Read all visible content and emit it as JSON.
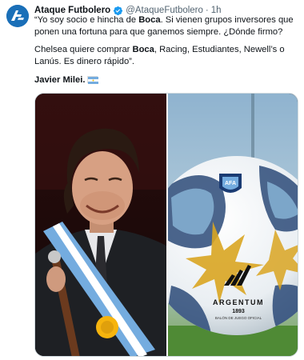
{
  "tweet": {
    "author_name": "Ataque Futbolero",
    "handle": "@AtaqueFutbolero",
    "separator": "·",
    "time": "1h",
    "paragraph1": {
      "pre": "“Yo soy socio e hincha de ",
      "bold": "Boca",
      "post": ". Si vienen grupos inversores que ponen una fortuna para que ganemos siempre. ¿Dónde firmo?"
    },
    "paragraph2": {
      "pre": "Chelsea quiere comprar ",
      "bold": "Boca",
      "post": ", Racing, Estudiantes, Newell’s o Lanús. Es dinero rápido”."
    },
    "signature": "Javier Milei.",
    "ball_text_main": "ARGENTUM",
    "ball_text_year": "1893",
    "ball_text_sub": "BALÓN DE JUEGO OFICIAL",
    "badge_text": "AFA"
  },
  "colors": {
    "verified": "#1d9bf0",
    "secondary_text": "#536471",
    "avatar_bg": "#1a6fb8",
    "sash_blue": "#74acdf"
  },
  "icons": {
    "avatar": "ataque-futbolero-logo",
    "verified": "verified-badge-icon",
    "flag": "argentina-flag-emoji"
  }
}
